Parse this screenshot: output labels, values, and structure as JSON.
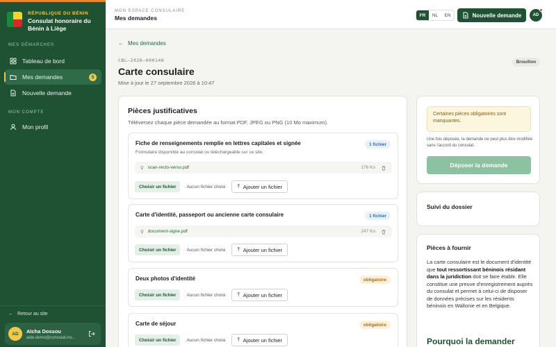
{
  "brand": {
    "country": "RÉPUBLIQUE DU BÉNIN",
    "name": "Consulat honoraire du Bénin à Liège"
  },
  "sidebar": {
    "section1": "MES DÉMARCHES",
    "items": [
      {
        "label": "Tableau de bord",
        "icon": "grid-icon"
      },
      {
        "label": "Mes demandes",
        "icon": "folder-icon",
        "badge": "5",
        "active": true
      },
      {
        "label": "Nouvelle demande",
        "icon": "document-plus-icon"
      }
    ],
    "section2": "MON COMPTE",
    "profile": {
      "label": "Mon profil",
      "icon": "user-icon"
    },
    "back": "Retour au site",
    "user": {
      "initials": "AD",
      "name": "Aïcha Dossou",
      "email": "aide.demo@consulat.inv..."
    }
  },
  "topbar": {
    "small": "MON ESPACE CONSULAIRE",
    "title": "Mes demandes",
    "langs": [
      "FR",
      "NL",
      "EN"
    ],
    "active_lang": "FR",
    "new_button": "Nouvelle demande",
    "avatar": "AD"
  },
  "page": {
    "back": "Mes demandes",
    "ref": "CBL–2026–000148",
    "title": "Carte consulaire",
    "updated": "Mise à jour le 27 septembre 2026 à 10:47",
    "status": "Brouillon"
  },
  "pieces": {
    "title": "Pièces justificatives",
    "subtitle": "Téléversez chaque pièce demandée au format PDF, JPEG ou PNG (10 Mo maximum).",
    "choose_label": "Choisir un fichier",
    "no_file_label": "Aucun fichier choisi",
    "add_label": "Ajouter un fichier",
    "items": [
      {
        "title": "Fiche de renseignements remplie en lettres capitales et signée",
        "desc": "Formulaire disponible au consulat ou téléchargeable sur ce site.",
        "tag": "1 fichier",
        "file": "scan-recto-verso.pdf",
        "size": "176 Ko"
      },
      {
        "title": "Carte d'identité, passeport ou ancienne carte consulaire",
        "tag": "1 fichier",
        "file": "document-signe.pdf",
        "size": "247 Ko"
      },
      {
        "title": "Deux photos d'identité",
        "tag": "obligatoire"
      },
      {
        "title": "Carte de séjour",
        "tag": "obligatoire"
      }
    ]
  },
  "aside": {
    "warning": "Certaines pièces obligatoires sont manquantes.",
    "note": "Une fois déposée, la demande ne peut plus être modifiée sans l'accord du consulat.",
    "deposit": "Déposer la demande",
    "tracking": "Suivi du dossier",
    "provide_title": "Pièces à fournir",
    "provide_text_1": "La carte consulaire est le document d'identité que ",
    "provide_bold": "tout ressortissant béninois résidant dans la juridiction",
    "provide_text_2": " doit se faire établir. Elle constitue une preuve d'enregistrement auprès du consulat et permet à celui-ci de disposer de données précises sur les résidents béninois en Wallonie et en Belgique.",
    "why_title": "Pourquoi la demander"
  },
  "colors": {
    "primary": "#1f5233",
    "accent": "#f1c947",
    "warning_bg": "#fdf6df",
    "deposit_disabled": "#8cc2a1"
  }
}
